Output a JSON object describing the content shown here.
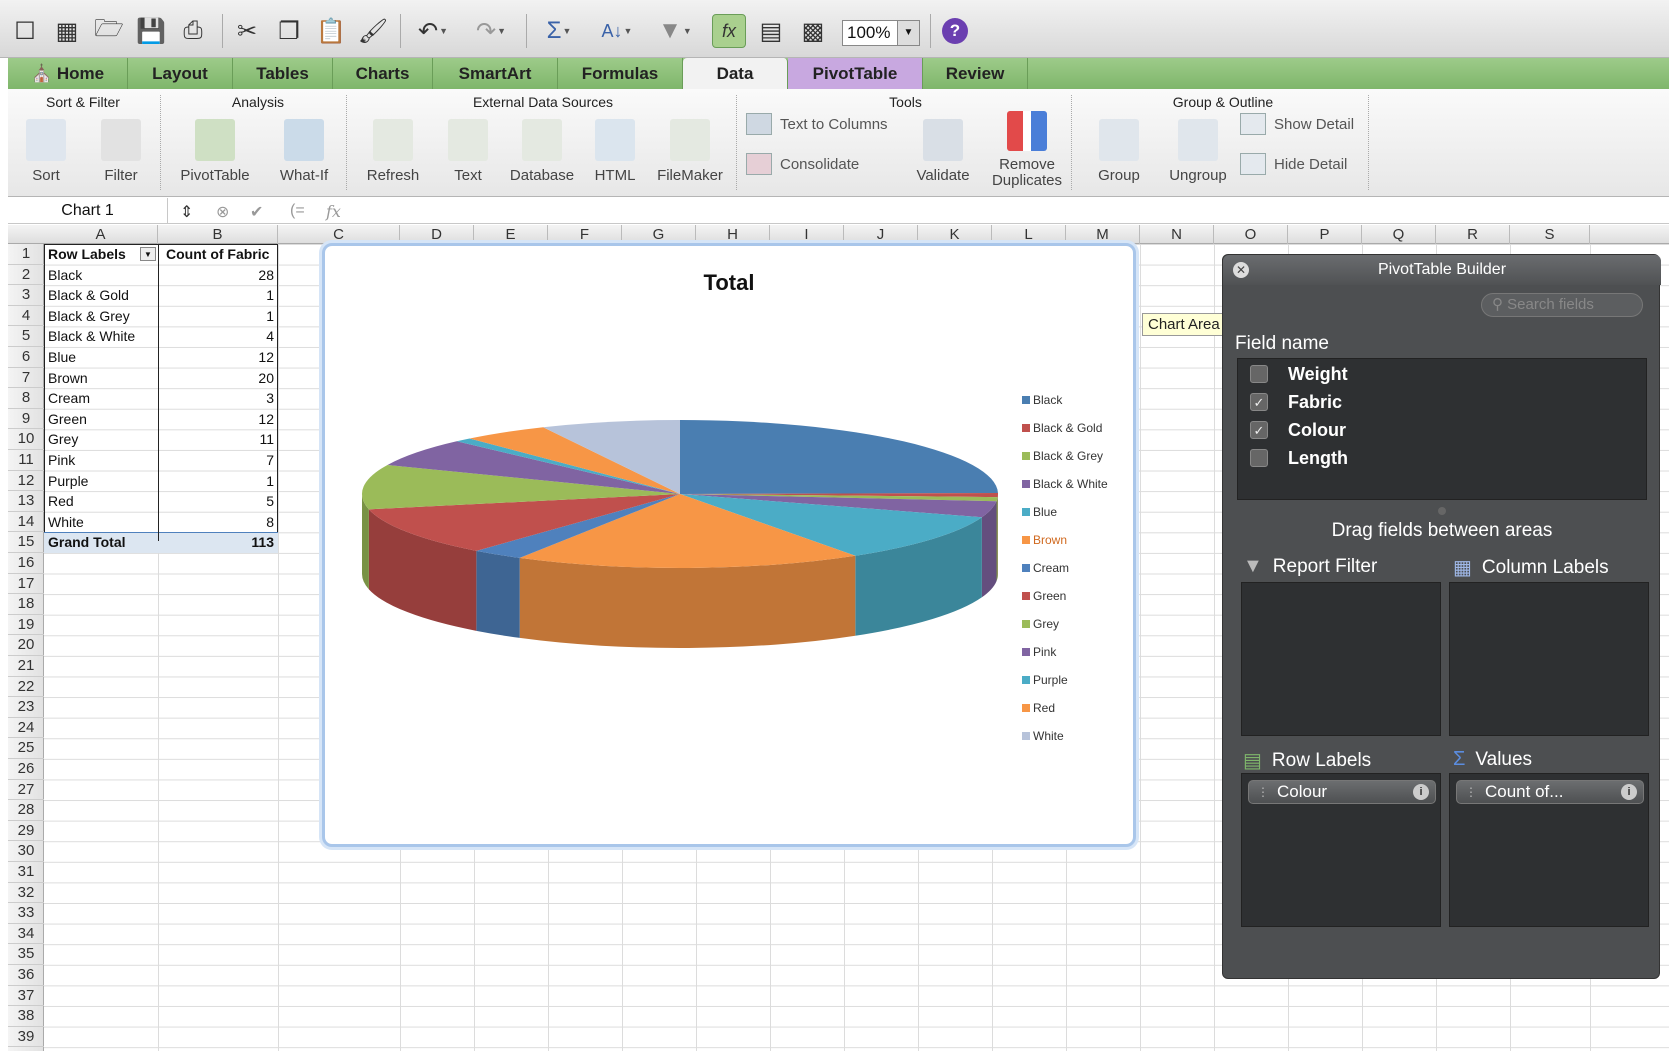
{
  "toolbar": {
    "zoom": "100%",
    "icons": [
      "new-icon",
      "templates-icon",
      "open-icon",
      "save-icon",
      "print-icon",
      "cut-icon",
      "copy-icon",
      "paste-icon",
      "format-painter-icon",
      "undo-icon",
      "redo-icon",
      "autosum-icon",
      "sort-icon",
      "filter-icon",
      "function-icon",
      "gallery-icon",
      "toolbox-icon",
      "help-icon"
    ]
  },
  "tabs": [
    "Home",
    "Layout",
    "Tables",
    "Charts",
    "SmartArt",
    "Formulas",
    "Data",
    "PivotTable",
    "Review"
  ],
  "ribbon": {
    "groups": [
      "Sort & Filter",
      "Analysis",
      "External Data Sources",
      "Tools",
      "Group & Outline"
    ],
    "buttons": {
      "sort": "Sort",
      "filter": "Filter",
      "pivottable": "PivotTable",
      "whatif": "What-If",
      "refresh": "Refresh",
      "text": "Text",
      "database": "Database",
      "html": "HTML",
      "filemaker": "FileMaker",
      "text_to_columns": "Text to Columns",
      "consolidate": "Consolidate",
      "validate": "Validate",
      "remove_dup_1": "Remove",
      "remove_dup_2": "Duplicates",
      "group": "Group",
      "ungroup": "Ungroup",
      "show_detail": "Show Detail",
      "hide_detail": "Hide Detail"
    }
  },
  "formula_bar": {
    "name_box": "Chart 1",
    "fx": "fx",
    "value": ""
  },
  "sheet": {
    "columns": [
      "A",
      "B",
      "C",
      "D",
      "E",
      "F",
      "G",
      "H",
      "I",
      "J",
      "K",
      "L",
      "M",
      "N",
      "O",
      "P",
      "Q",
      "R",
      "S"
    ],
    "rows": [
      "1",
      "2",
      "3",
      "4",
      "5",
      "6",
      "7",
      "8",
      "9",
      "10",
      "11",
      "12",
      "13",
      "14",
      "15",
      "16",
      "17",
      "18",
      "19",
      "20",
      "21",
      "22",
      "23",
      "24",
      "25",
      "26",
      "27",
      "28",
      "29",
      "30",
      "31",
      "32",
      "33",
      "34",
      "35",
      "36",
      "37",
      "38",
      "39"
    ],
    "pivot": {
      "header": [
        "Row Labels",
        "Count of Fabric"
      ],
      "rows": [
        [
          "Black",
          "28"
        ],
        [
          "Black & Gold",
          "1"
        ],
        [
          "Black & Grey",
          "1"
        ],
        [
          "Black & White",
          "4"
        ],
        [
          "Blue",
          "12"
        ],
        [
          "Brown",
          "20"
        ],
        [
          "Cream",
          "3"
        ],
        [
          "Green",
          "12"
        ],
        [
          "Grey",
          "11"
        ],
        [
          "Pink",
          "7"
        ],
        [
          "Purple",
          "1"
        ],
        [
          "Red",
          "5"
        ],
        [
          "White",
          "8"
        ]
      ],
      "total": [
        "Grand Total",
        "113"
      ]
    }
  },
  "tooltip": "Chart Area",
  "chart_data": {
    "type": "pie",
    "title": "Total",
    "categories": [
      "Black",
      "Black & Gold",
      "Black & Grey",
      "Black & White",
      "Blue",
      "Brown",
      "Cream",
      "Green",
      "Grey",
      "Pink",
      "Purple",
      "Red",
      "White"
    ],
    "values": [
      28,
      1,
      1,
      4,
      12,
      20,
      3,
      12,
      11,
      7,
      1,
      5,
      8
    ],
    "colors": [
      "#4a7eb1",
      "#c0504d",
      "#9bbb59",
      "#8064a2",
      "#4bacc6",
      "#f79646",
      "#4f81bd",
      "#c0504d",
      "#9bbb59",
      "#8064a2",
      "#4bacc6",
      "#f79646",
      "#b7c3da"
    ],
    "legend": "right",
    "three_d": true
  },
  "builder": {
    "title": "PivotTable Builder",
    "search_placeholder": "Search fields",
    "field_name_label": "Field name",
    "fields": [
      {
        "name": "Weight",
        "checked": false
      },
      {
        "name": "Fabric",
        "checked": true
      },
      {
        "name": "Colour",
        "checked": true
      },
      {
        "name": "Length",
        "checked": false
      }
    ],
    "drag_hint": "Drag fields between areas",
    "areas": {
      "report_filter": "Report Filter",
      "column_labels": "Column Labels",
      "row_labels": "Row Labels",
      "values": "Values"
    },
    "row_field": "Colour",
    "value_field": "Count of..."
  }
}
